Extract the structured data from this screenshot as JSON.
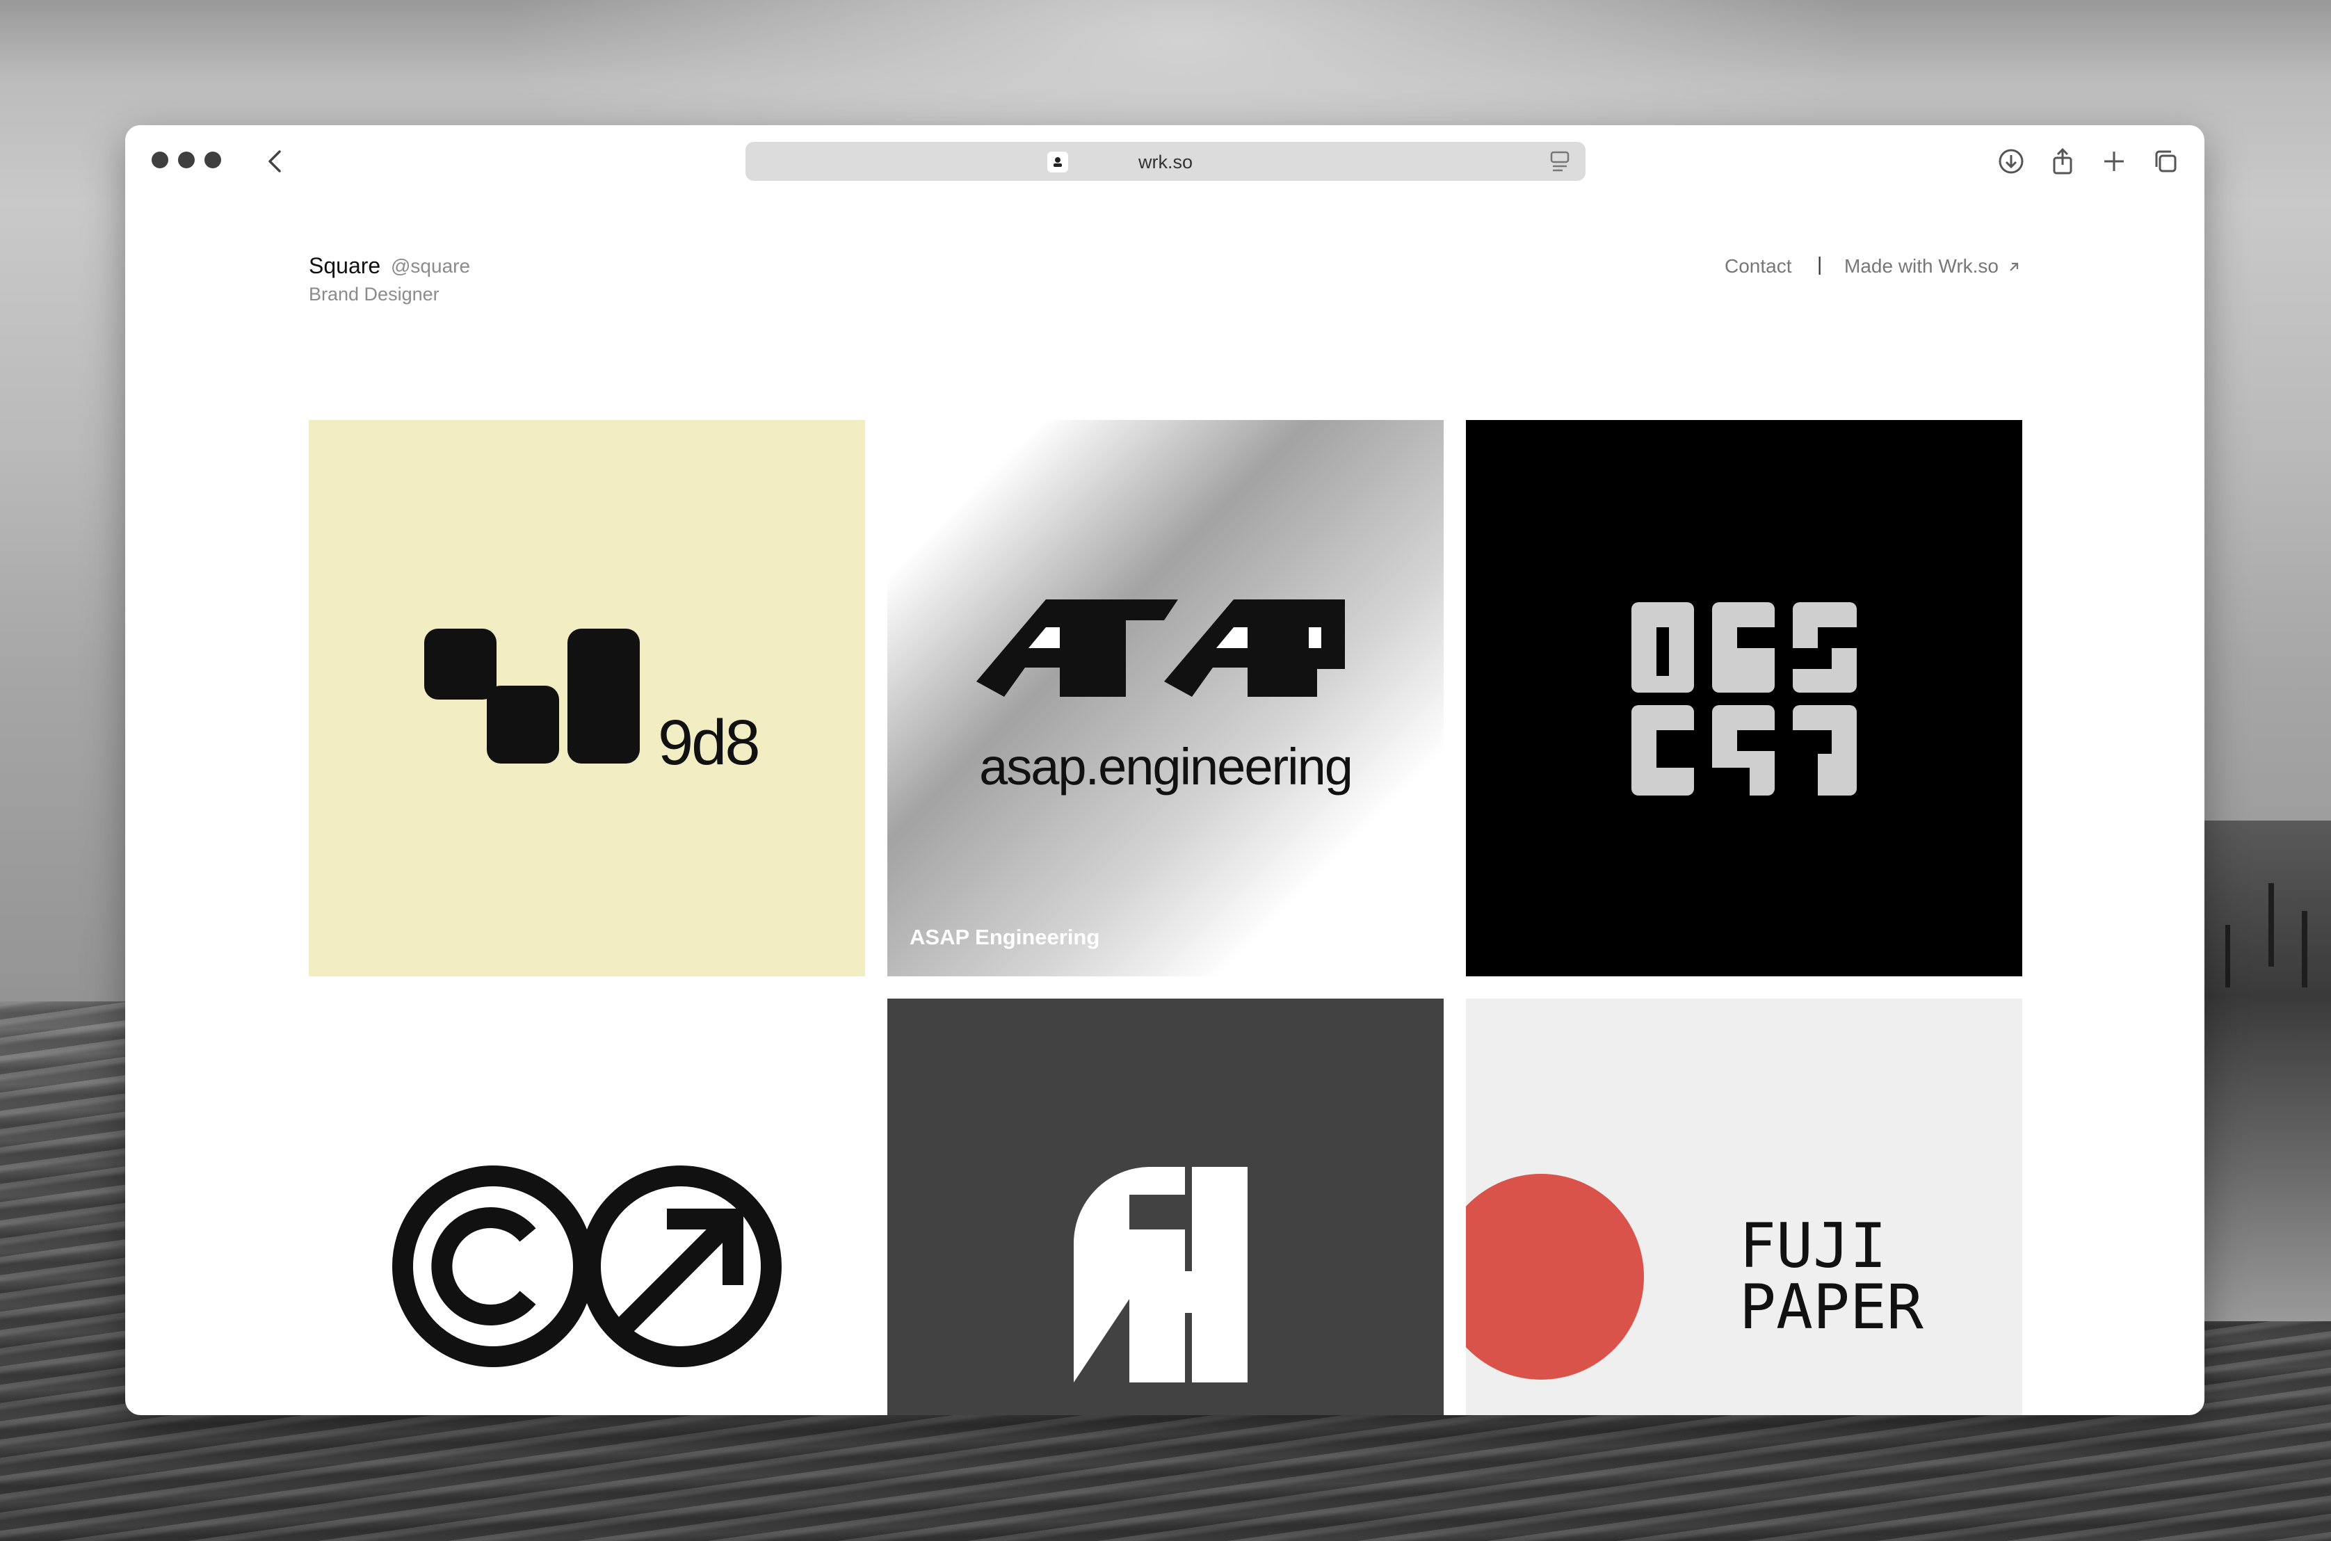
{
  "browser": {
    "url": "wrk.so"
  },
  "header": {
    "name": "Square",
    "handle": "@square",
    "role": "Brand Designer"
  },
  "nav": {
    "contact": "Contact",
    "separator": "|",
    "made_with": "Made with Wrk.so"
  },
  "projects": [
    {
      "logo_text": "9d8",
      "background": "#f2edc3"
    },
    {
      "logo_text": "asap.engineering",
      "caption": "ASAP Engineering"
    },
    {
      "background": "#000000"
    },
    {
      "background": "#ffffff"
    },
    {
      "background": "#424242"
    },
    {
      "logo_text_line1": "FUJI",
      "logo_text_line2": "PAPER",
      "accent": "#d9534a",
      "background": "#efefef"
    }
  ]
}
